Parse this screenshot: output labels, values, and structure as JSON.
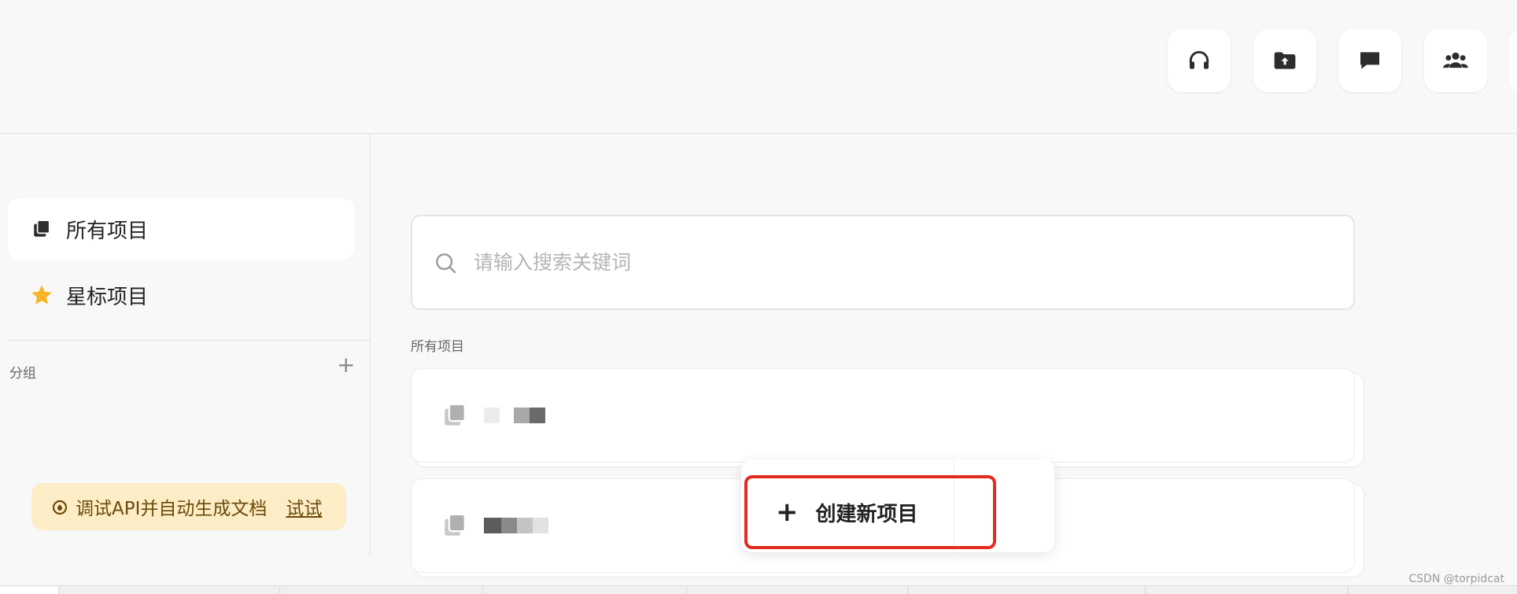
{
  "topbar": {
    "buttons": [
      {
        "icon": "headphones-icon"
      },
      {
        "icon": "folder-upload-icon"
      },
      {
        "icon": "chat-icon"
      },
      {
        "icon": "team-icon"
      }
    ]
  },
  "sidebar": {
    "items": [
      {
        "label": "所有项目",
        "icon": "stacked-squares-icon",
        "active": true
      },
      {
        "label": "星标项目",
        "icon": "star-icon",
        "active": false
      }
    ],
    "group_label": "分组",
    "group_add": "+"
  },
  "promo": {
    "text": "调试API并自动生成文档",
    "link": "试试"
  },
  "search": {
    "placeholder": "请输入搜索关键词"
  },
  "main": {
    "section_title": "所有项目"
  },
  "popup": {
    "plus": "+",
    "create_label": "创建新项目"
  },
  "watermark": "CSDN @torpidcat",
  "colors": {
    "accent_red": "#e32b22",
    "star": "#f6b526",
    "promo_bg": "#fdedc6"
  }
}
